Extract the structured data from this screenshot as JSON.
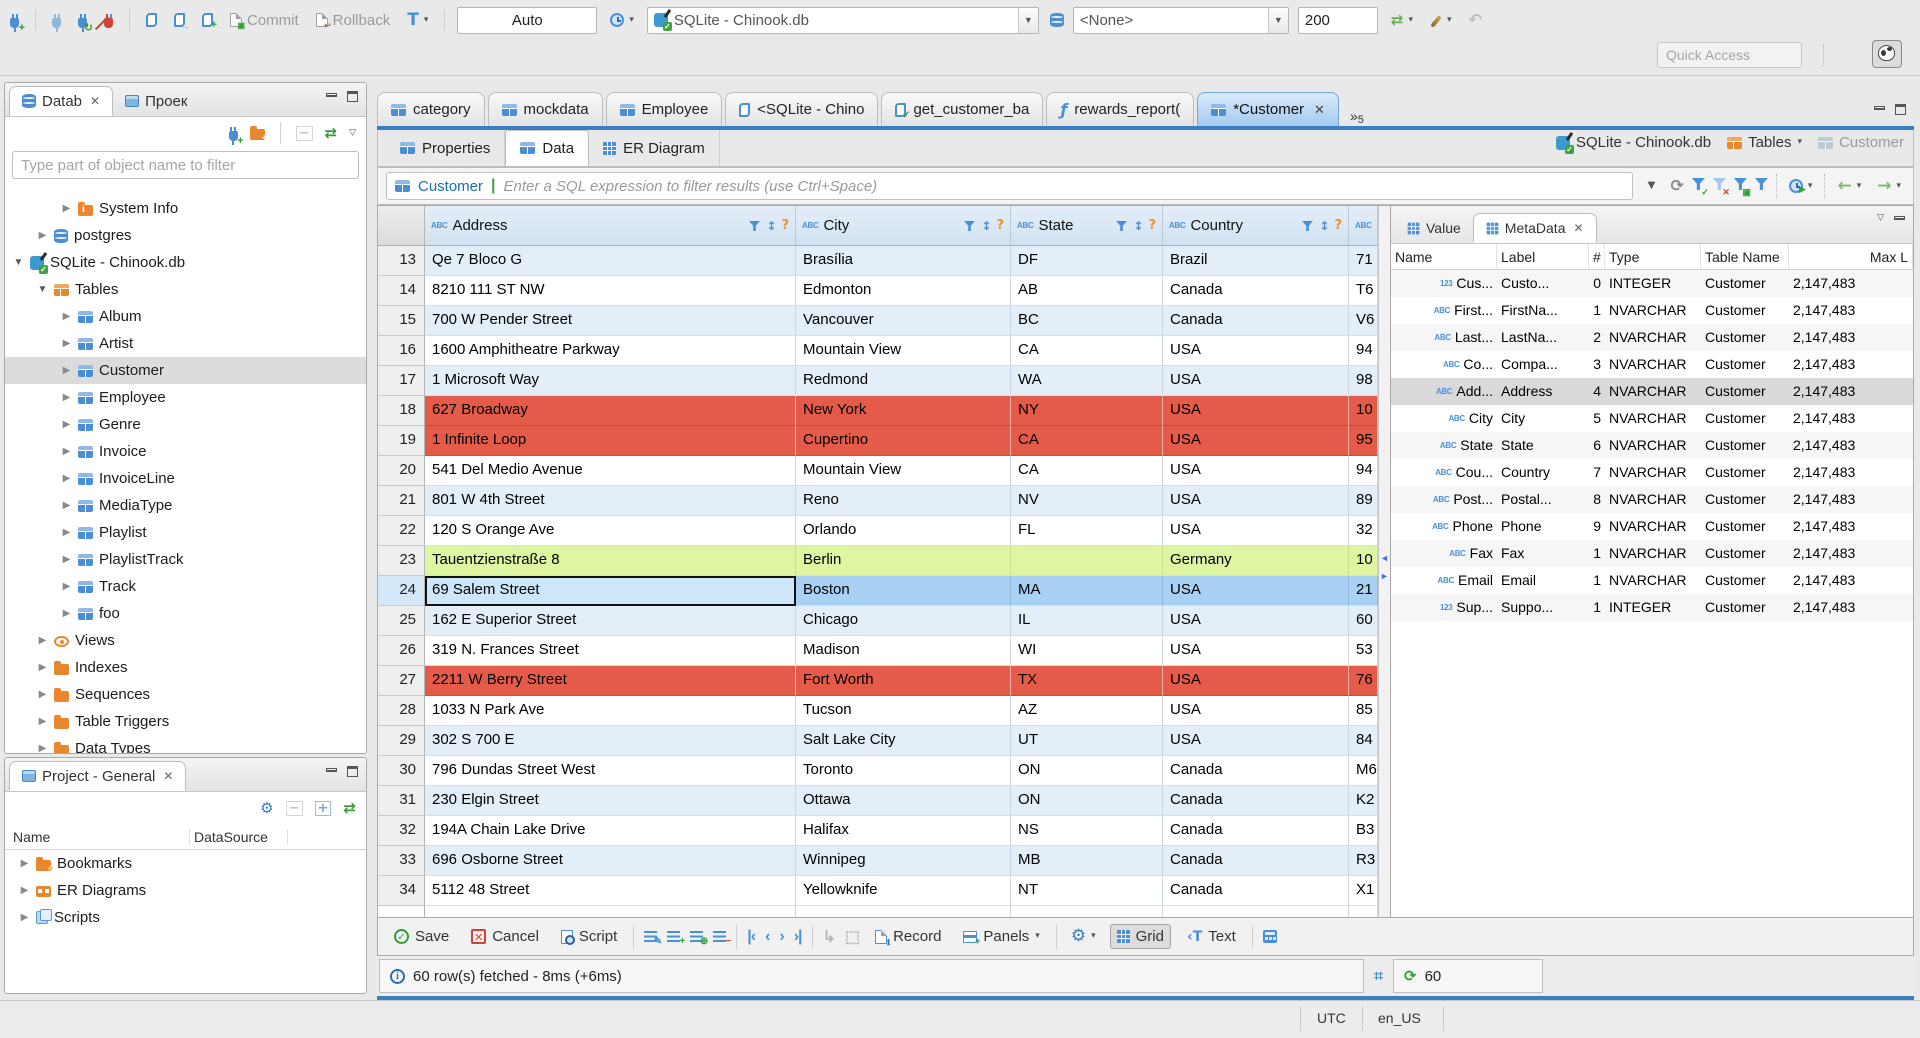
{
  "toolbar": {
    "commit_label": "Commit",
    "rollback_label": "Rollback",
    "autocommit_value": "Auto",
    "datasource_value": "SQLite - Chinook.db",
    "schema_value": "<None>",
    "fetch_size": "200",
    "quick_access_placeholder": "Quick Access"
  },
  "editor": {
    "tabs": [
      {
        "label": "category",
        "icon": "table",
        "active": false
      },
      {
        "label": "mockdata",
        "icon": "table",
        "active": false
      },
      {
        "label": "Employee",
        "icon": "table",
        "active": false
      },
      {
        "label": "<SQLite - Chino",
        "icon": "script",
        "active": false
      },
      {
        "label": "get_customer_ba",
        "icon": "script-check",
        "active": false
      },
      {
        "label": "rewards_report(",
        "icon": "func",
        "active": false
      },
      {
        "label": "*Customer",
        "icon": "table",
        "active": true,
        "close": true
      }
    ],
    "overflow_count": "5",
    "subtabs": [
      {
        "label": "Properties",
        "icon": "table",
        "active": false
      },
      {
        "label": "Data",
        "icon": "table",
        "active": true
      },
      {
        "label": "ER Diagram",
        "icon": "er-nodes",
        "active": false
      }
    ],
    "breadcrumb": [
      {
        "label": "SQLite - Chinook.db",
        "icon": "sqlite-db",
        "dim": false,
        "caret": false
      },
      {
        "label": "Tables",
        "icon": "tables",
        "dim": false,
        "caret": true
      },
      {
        "label": "Customer",
        "icon": "table-grey",
        "dim": true,
        "caret": false
      }
    ]
  },
  "filter": {
    "table_name": "Customer",
    "placeholder": "Enter a SQL expression to filter results (use Ctrl+Space)"
  },
  "grid": {
    "columns": [
      "Address",
      "City",
      "State",
      "Country",
      ""
    ],
    "rows": [
      {
        "n": "13",
        "v": [
          "Qe 7 Bloco G",
          "Brasília",
          "DF",
          "Brazil",
          "71"
        ],
        "t": "alt"
      },
      {
        "n": "14",
        "v": [
          "8210 111 ST NW",
          "Edmonton",
          "AB",
          "Canada",
          "T6"
        ],
        "t": "w"
      },
      {
        "n": "15",
        "v": [
          "700 W Pender Street",
          "Vancouver",
          "BC",
          "Canada",
          "V6"
        ],
        "t": "alt"
      },
      {
        "n": "16",
        "v": [
          "1600 Amphitheatre Parkway",
          "Mountain View",
          "CA",
          "USA",
          "94"
        ],
        "t": "w"
      },
      {
        "n": "17",
        "v": [
          "1 Microsoft Way",
          "Redmond",
          "WA",
          "USA",
          "98"
        ],
        "t": "alt"
      },
      {
        "n": "18",
        "v": [
          "627 Broadway",
          "New York",
          "NY",
          "USA",
          "10"
        ],
        "t": "red"
      },
      {
        "n": "19",
        "v": [
          "1 Infinite Loop",
          "Cupertino",
          "CA",
          "USA",
          "95"
        ],
        "t": "red"
      },
      {
        "n": "20",
        "v": [
          "541 Del Medio Avenue",
          "Mountain View",
          "CA",
          "USA",
          "94"
        ],
        "t": "w"
      },
      {
        "n": "21",
        "v": [
          "801 W 4th Street",
          "Reno",
          "NV",
          "USA",
          "89"
        ],
        "t": "alt"
      },
      {
        "n": "22",
        "v": [
          "120 S Orange Ave",
          "Orlando",
          "FL",
          "USA",
          "32"
        ],
        "t": "w"
      },
      {
        "n": "23",
        "v": [
          "Tauentzienstraße 8",
          "Berlin",
          "",
          "Germany",
          "10"
        ],
        "t": "green"
      },
      {
        "n": "24",
        "v": [
          "69 Salem Street",
          "Boston",
          "MA",
          "USA",
          "21"
        ],
        "t": "sel"
      },
      {
        "n": "25",
        "v": [
          "162 E Superior Street",
          "Chicago",
          "IL",
          "USA",
          "60"
        ],
        "t": "alt"
      },
      {
        "n": "26",
        "v": [
          "319 N. Frances Street",
          "Madison",
          "WI",
          "USA",
          "53"
        ],
        "t": "w"
      },
      {
        "n": "27",
        "v": [
          "2211 W Berry Street",
          "Fort Worth",
          "TX",
          "USA",
          "76"
        ],
        "t": "red"
      },
      {
        "n": "28",
        "v": [
          "1033 N Park Ave",
          "Tucson",
          "AZ",
          "USA",
          "85"
        ],
        "t": "w"
      },
      {
        "n": "29",
        "v": [
          "302 S 700 E",
          "Salt Lake City",
          "UT",
          "USA",
          "84"
        ],
        "t": "alt"
      },
      {
        "n": "30",
        "v": [
          "796 Dundas Street West",
          "Toronto",
          "ON",
          "Canada",
          "M6"
        ],
        "t": "w"
      },
      {
        "n": "31",
        "v": [
          "230 Elgin Street",
          "Ottawa",
          "ON",
          "Canada",
          "K2"
        ],
        "t": "alt"
      },
      {
        "n": "32",
        "v": [
          "194A Chain Lake Drive",
          "Halifax",
          "NS",
          "Canada",
          "B3"
        ],
        "t": "w"
      },
      {
        "n": "33",
        "v": [
          "696 Osborne Street",
          "Winnipeg",
          "MB",
          "Canada",
          "R3"
        ],
        "t": "alt"
      },
      {
        "n": "34",
        "v": [
          "5112 48 Street",
          "Yellowknife",
          "NT",
          "Canada",
          "X1"
        ],
        "t": "w"
      }
    ]
  },
  "metadata": {
    "tabs": [
      {
        "label": "Value",
        "active": false
      },
      {
        "label": "MetaData",
        "active": true,
        "close": true
      }
    ],
    "columns": [
      "Name",
      "Label",
      "#",
      "Type",
      "Table Name",
      "Max L"
    ],
    "rows": [
      {
        "ic": "123",
        "name": "Cus...",
        "label": "Custo...",
        "num": "0",
        "type": "INTEGER",
        "tbl": "Customer",
        "max": "2,147,483",
        "sel": false
      },
      {
        "ic": "abc",
        "name": "First...",
        "label": "FirstNa...",
        "num": "1",
        "type": "NVARCHAR",
        "tbl": "Customer",
        "max": "2,147,483",
        "sel": false
      },
      {
        "ic": "abc",
        "name": "Last...",
        "label": "LastNa...",
        "num": "2",
        "type": "NVARCHAR",
        "tbl": "Customer",
        "max": "2,147,483",
        "sel": false
      },
      {
        "ic": "abc",
        "name": "Co...",
        "label": "Compa...",
        "num": "3",
        "type": "NVARCHAR",
        "tbl": "Customer",
        "max": "2,147,483",
        "sel": false
      },
      {
        "ic": "abc",
        "name": "Add...",
        "label": "Address",
        "num": "4",
        "type": "NVARCHAR",
        "tbl": "Customer",
        "max": "2,147,483",
        "sel": true
      },
      {
        "ic": "abc",
        "name": "City",
        "label": "City",
        "num": "5",
        "type": "NVARCHAR",
        "tbl": "Customer",
        "max": "2,147,483",
        "sel": false
      },
      {
        "ic": "abc",
        "name": "State",
        "label": "State",
        "num": "6",
        "type": "NVARCHAR",
        "tbl": "Customer",
        "max": "2,147,483",
        "sel": false
      },
      {
        "ic": "abc",
        "name": "Cou...",
        "label": "Country",
        "num": "7",
        "type": "NVARCHAR",
        "tbl": "Customer",
        "max": "2,147,483",
        "sel": false
      },
      {
        "ic": "abc",
        "name": "Post...",
        "label": "Postal...",
        "num": "8",
        "type": "NVARCHAR",
        "tbl": "Customer",
        "max": "2,147,483",
        "sel": false
      },
      {
        "ic": "abc",
        "name": "Phone",
        "label": "Phone",
        "num": "9",
        "type": "NVARCHAR",
        "tbl": "Customer",
        "max": "2,147,483",
        "sel": false
      },
      {
        "ic": "abc",
        "name": "Fax",
        "label": "Fax",
        "num": "1",
        "type": "NVARCHAR",
        "tbl": "Customer",
        "max": "2,147,483",
        "sel": false
      },
      {
        "ic": "abc",
        "name": "Email",
        "label": "Email",
        "num": "1",
        "type": "NVARCHAR",
        "tbl": "Customer",
        "max": "2,147,483",
        "sel": false
      },
      {
        "ic": "123",
        "name": "Sup...",
        "label": "Suppo...",
        "num": "1",
        "type": "INTEGER",
        "tbl": "Customer",
        "max": "2,147,483",
        "sel": false
      }
    ]
  },
  "sidebar": {
    "tabs": [
      {
        "label": "Datab",
        "active": true,
        "close": true
      },
      {
        "label": "Проек",
        "active": false
      }
    ],
    "filter_placeholder": "Type part of object name to filter",
    "tree": [
      {
        "indent": 2,
        "arrow": "r",
        "icon": "folder-info",
        "label": "System Info",
        "sel": false
      },
      {
        "indent": 1,
        "arrow": "r",
        "icon": "db",
        "label": "postgres",
        "sel": false
      },
      {
        "indent": 0,
        "arrow": "d",
        "icon": "sqlite-db",
        "label": "SQLite - Chinook.db",
        "sel": false
      },
      {
        "indent": 1,
        "arrow": "d",
        "icon": "tables",
        "label": "Tables",
        "sel": false
      },
      {
        "indent": 2,
        "arrow": "r",
        "icon": "table",
        "label": "Album",
        "sel": false
      },
      {
        "indent": 2,
        "arrow": "r",
        "icon": "table",
        "label": "Artist",
        "sel": false
      },
      {
        "indent": 2,
        "arrow": "r",
        "icon": "table",
        "label": "Customer",
        "sel": true
      },
      {
        "indent": 2,
        "arrow": "r",
        "icon": "table",
        "label": "Employee",
        "sel": false
      },
      {
        "indent": 2,
        "arrow": "r",
        "icon": "table",
        "label": "Genre",
        "sel": false
      },
      {
        "indent": 2,
        "arrow": "r",
        "icon": "table",
        "label": "Invoice",
        "sel": false
      },
      {
        "indent": 2,
        "arrow": "r",
        "icon": "table",
        "label": "InvoiceLine",
        "sel": false
      },
      {
        "indent": 2,
        "arrow": "r",
        "icon": "table",
        "label": "MediaType",
        "sel": false
      },
      {
        "indent": 2,
        "arrow": "r",
        "icon": "table",
        "label": "Playlist",
        "sel": false
      },
      {
        "indent": 2,
        "arrow": "r",
        "icon": "table",
        "label": "PlaylistTrack",
        "sel": false
      },
      {
        "indent": 2,
        "arrow": "r",
        "icon": "table",
        "label": "Track",
        "sel": false
      },
      {
        "indent": 2,
        "arrow": "r",
        "icon": "table",
        "label": "foo",
        "sel": false
      },
      {
        "indent": 1,
        "arrow": "r",
        "icon": "eye",
        "label": "Views",
        "sel": false
      },
      {
        "indent": 1,
        "arrow": "r",
        "icon": "folder",
        "label": "Indexes",
        "sel": false
      },
      {
        "indent": 1,
        "arrow": "r",
        "icon": "folder",
        "label": "Sequences",
        "sel": false
      },
      {
        "indent": 1,
        "arrow": "r",
        "icon": "folder",
        "label": "Table Triggers",
        "sel": false
      },
      {
        "indent": 1,
        "arrow": "r",
        "icon": "folder",
        "label": "Data Types",
        "sel": false
      }
    ]
  },
  "project": {
    "title": "Project - General",
    "columns": [
      "Name",
      "DataSource"
    ],
    "items": [
      {
        "icon": "folder-star",
        "label": "Bookmarks"
      },
      {
        "icon": "er-folder",
        "label": "ER Diagrams"
      },
      {
        "icon": "scripts",
        "label": "Scripts"
      }
    ]
  },
  "bottombar": {
    "save_label": "Save",
    "cancel_label": "Cancel",
    "script_label": "Script",
    "record_label": "Record",
    "panels_label": "Panels",
    "grid_label": "Grid",
    "text_label": "Text"
  },
  "status": {
    "fetch_message": "60 row(s) fetched - 8ms (+6ms)",
    "refresh_count": "60",
    "timezone": "UTC",
    "locale": "en_US"
  }
}
